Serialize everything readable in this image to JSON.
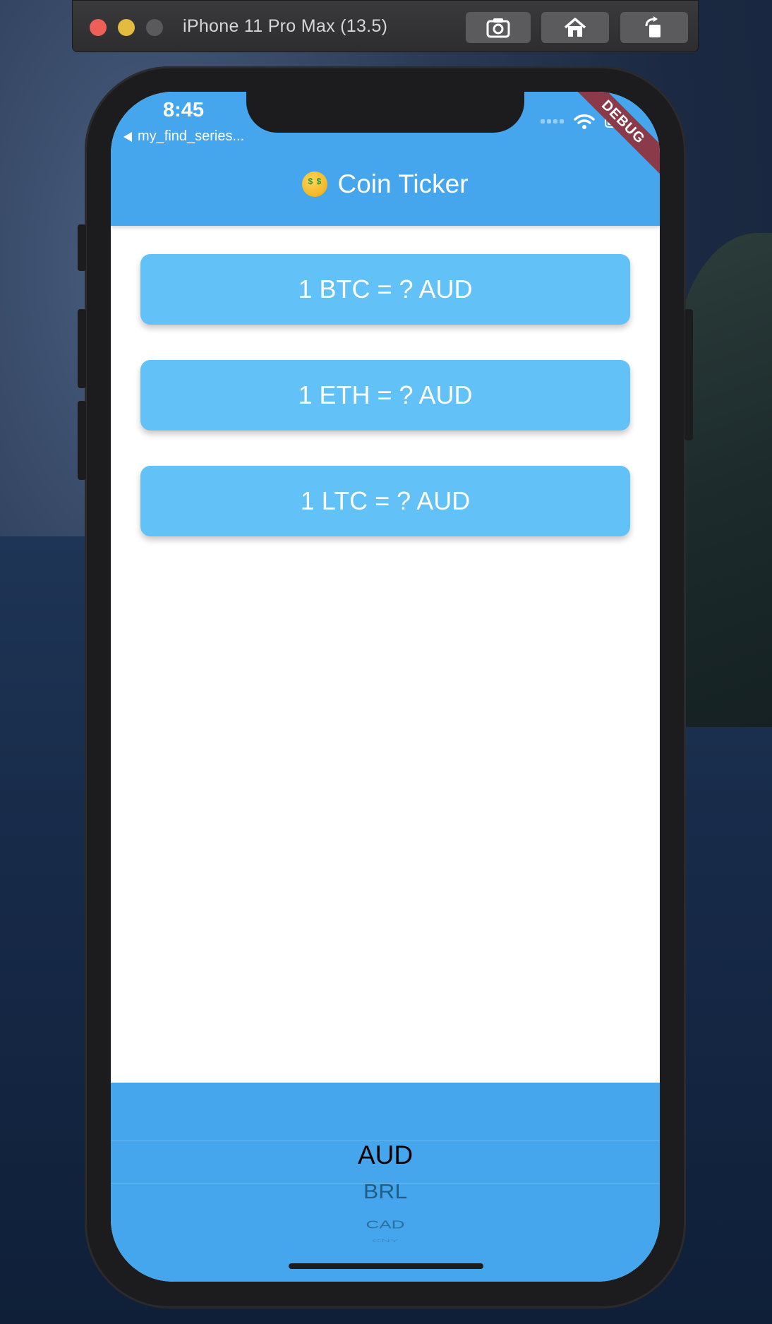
{
  "simulator": {
    "title": "iPhone 11 Pro Max (13.5)",
    "buttons": [
      "screenshot-icon",
      "home-icon",
      "rotate-icon"
    ]
  },
  "status_bar": {
    "time": "8:45",
    "back_app": "my_find_series..."
  },
  "debug_banner": "DEBUG",
  "app_bar": {
    "title": "Coin Ticker",
    "emoji": "money-mouth-face-icon"
  },
  "cards": [
    {
      "label": "1 BTC = ? AUD"
    },
    {
      "label": "1 ETH = ? AUD"
    },
    {
      "label": "1 LTC = ? AUD"
    }
  ],
  "picker": {
    "selected": "AUD",
    "items": [
      "AUD",
      "BRL",
      "CAD",
      "CNY"
    ]
  },
  "colors": {
    "app_bar": "#45a6ed",
    "card": "#62c1f7",
    "picker_bg": "#45a6ed"
  }
}
